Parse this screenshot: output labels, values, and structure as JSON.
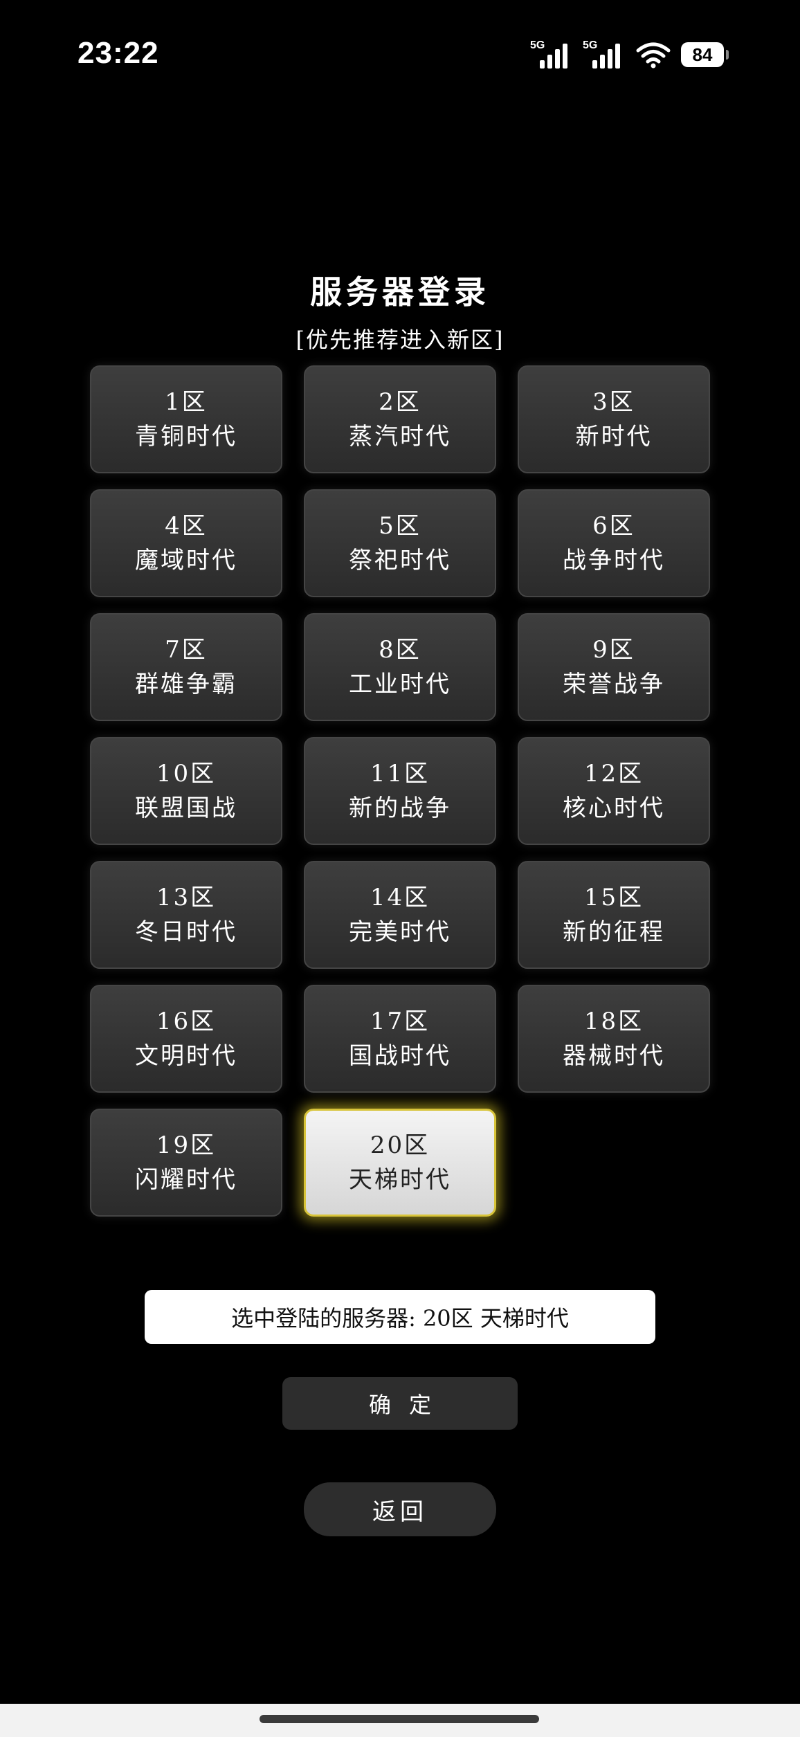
{
  "status_bar": {
    "time": "23:22",
    "sim1_label": "5G",
    "sim2_label": "5G",
    "battery": "84"
  },
  "header": {
    "title": "服务器登录",
    "subtitle": "[优先推荐进入新区]"
  },
  "servers": [
    {
      "num": "1区",
      "name": "青铜时代"
    },
    {
      "num": "2区",
      "name": "蒸汽时代"
    },
    {
      "num": "3区",
      "name": "新时代"
    },
    {
      "num": "4区",
      "name": "魔域时代"
    },
    {
      "num": "5区",
      "name": "祭祀时代"
    },
    {
      "num": "6区",
      "name": "战争时代"
    },
    {
      "num": "7区",
      "name": "群雄争霸"
    },
    {
      "num": "8区",
      "name": "工业时代"
    },
    {
      "num": "9区",
      "name": "荣誉战争"
    },
    {
      "num": "10区",
      "name": "联盟国战"
    },
    {
      "num": "11区",
      "name": "新的战争"
    },
    {
      "num": "12区",
      "name": "核心时代"
    },
    {
      "num": "13区",
      "name": "冬日时代"
    },
    {
      "num": "14区",
      "name": "完美时代"
    },
    {
      "num": "15区",
      "name": "新的征程"
    },
    {
      "num": "16区",
      "name": "文明时代"
    },
    {
      "num": "17区",
      "name": "国战时代"
    },
    {
      "num": "18区",
      "name": "器械时代"
    },
    {
      "num": "19区",
      "name": "闪耀时代"
    },
    {
      "num": "20区",
      "name": "天梯时代"
    }
  ],
  "selected_index": 19,
  "selection": {
    "label": "选中登陆的服务器:",
    "value": "20区 天梯时代"
  },
  "buttons": {
    "confirm": "确定",
    "back": "返回"
  },
  "colors": {
    "background": "#000000",
    "button": "#2d2d2d",
    "selected_glow": "#d8c43a"
  }
}
